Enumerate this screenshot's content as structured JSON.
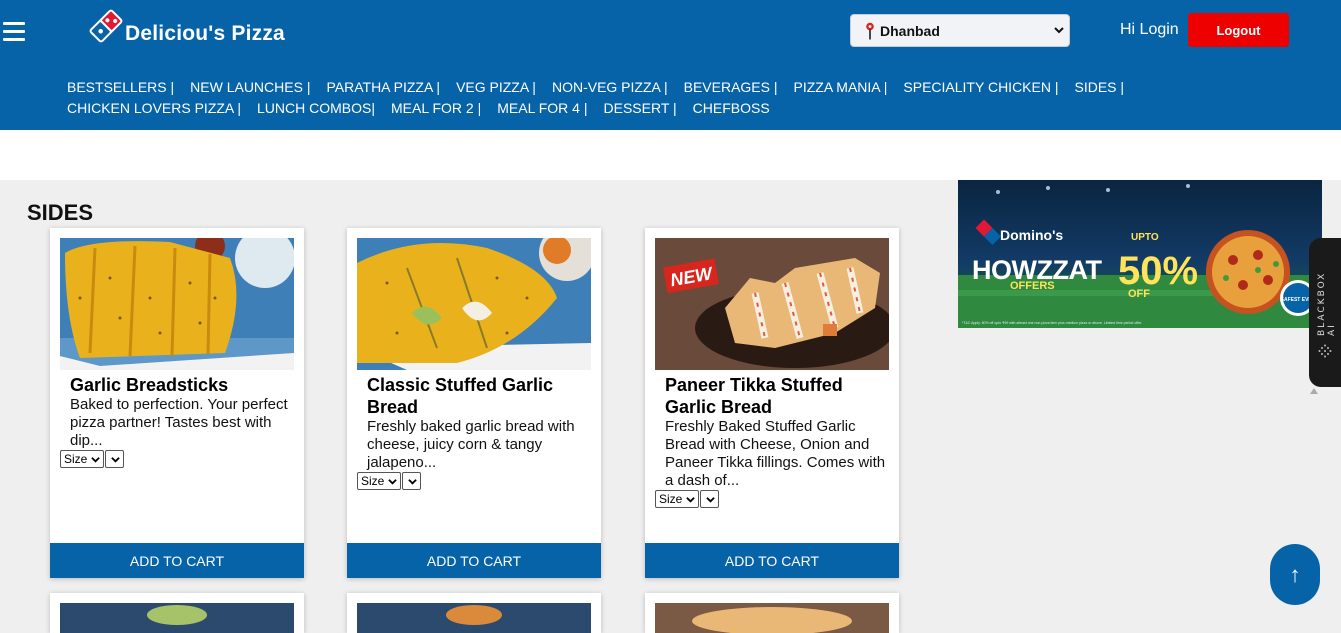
{
  "header": {
    "brand": "Deliciou's Pizza",
    "city": "Dhanbad",
    "login_label": "Hi Login",
    "logout_label": "Logout"
  },
  "nav": {
    "line1": [
      "BESTSELLERS |",
      "NEW LAUNCHES |",
      "PARATHA PIZZA |",
      "VEG PIZZA |",
      "NON-VEG PIZZA |",
      "BEVERAGES |",
      "PIZZA MANIA |",
      "SPECIALITY CHICKEN |",
      "SIDES |"
    ],
    "line2": [
      "CHICKEN LOVERS PIZZA |",
      "LUNCH COMBOS|",
      "MEAL FOR 2 |",
      "MEAL FOR 4 |",
      "DESSERT |",
      "CHEFBOSS"
    ]
  },
  "section": {
    "title": "SIDES"
  },
  "products": [
    {
      "name": "Garlic Breadsticks",
      "desc": "Baked to perfection. Your perfect pizza partner! Tastes best with dip...",
      "size_label": "Size",
      "cta": "ADD TO CART"
    },
    {
      "name": "Classic Stuffed Garlic Bread",
      "desc": "Freshly baked garlic bread with cheese, juicy corn & tangy jalapeno...",
      "size_label": "Size",
      "cta": "ADD TO CART"
    },
    {
      "name": "Paneer Tikka Stuffed Garlic Bread",
      "desc": "Freshly Baked Stuffed Garlic Bread with Cheese, Onion and Paneer Tikka fillings. Comes with a dash of...",
      "badge": "NEW",
      "size_label": "Size",
      "cta": "ADD TO CART"
    }
  ],
  "banner": {
    "brand": "Domino's",
    "headline": "HOWZZAT",
    "sub": "OFFERS",
    "upto": "UPTO",
    "discount": "50%",
    "off": "OFF",
    "seal": "SAFEST EVER",
    "fine_print": "*T&C Apply. 50% off upto ₹99 with atleast one non-pizza item plus medium pizza or above. Limited time period offer."
  },
  "widget": {
    "label": "BLACKBOX AI"
  },
  "scroll_top": {
    "label": "↑"
  },
  "icons": {
    "menu": "hamburger-icon",
    "location": "location-pin-icon",
    "dropdown": "chevron-down-icon",
    "logo": "domino-tile-icon"
  },
  "colors": {
    "brand_blue": "#0663a8",
    "logout_red": "#ee0000",
    "page_bg": "#efefef"
  }
}
